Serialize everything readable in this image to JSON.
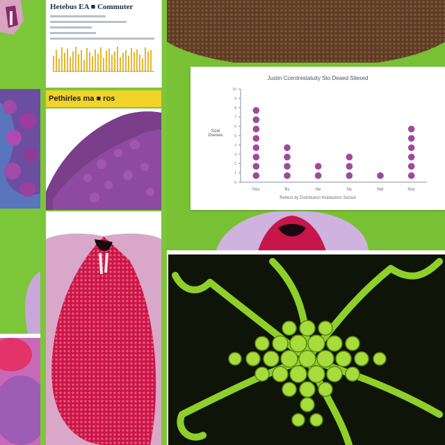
{
  "document": {
    "title": "Hetebus EA ■ Commuter",
    "banner": "Pethirles ma ■ ros"
  },
  "chart": {
    "title": "Justin Ccentrestatuity Sto Deaed Sliesed",
    "ylabel": "Sizel Dsesies",
    "footer": "Rettest dy Distribution thuidastion Selzed",
    "axis_color": "#8a8fa0",
    "point_color": "#8d2a8a"
  },
  "chart_data": {
    "type": "scatter",
    "title": "Justin Ccentrestatuity Sto Deaed Sliesed",
    "xlabel": "",
    "ylabel": "Sizel Dsesies",
    "categories": [
      "Nes",
      "Bs",
      "Ne",
      "Ns",
      "Nel",
      "Nos"
    ],
    "values": [
      8,
      4,
      2,
      3,
      1,
      6
    ],
    "ylim": [
      0,
      10
    ],
    "grid": false,
    "legend": "none"
  }
}
